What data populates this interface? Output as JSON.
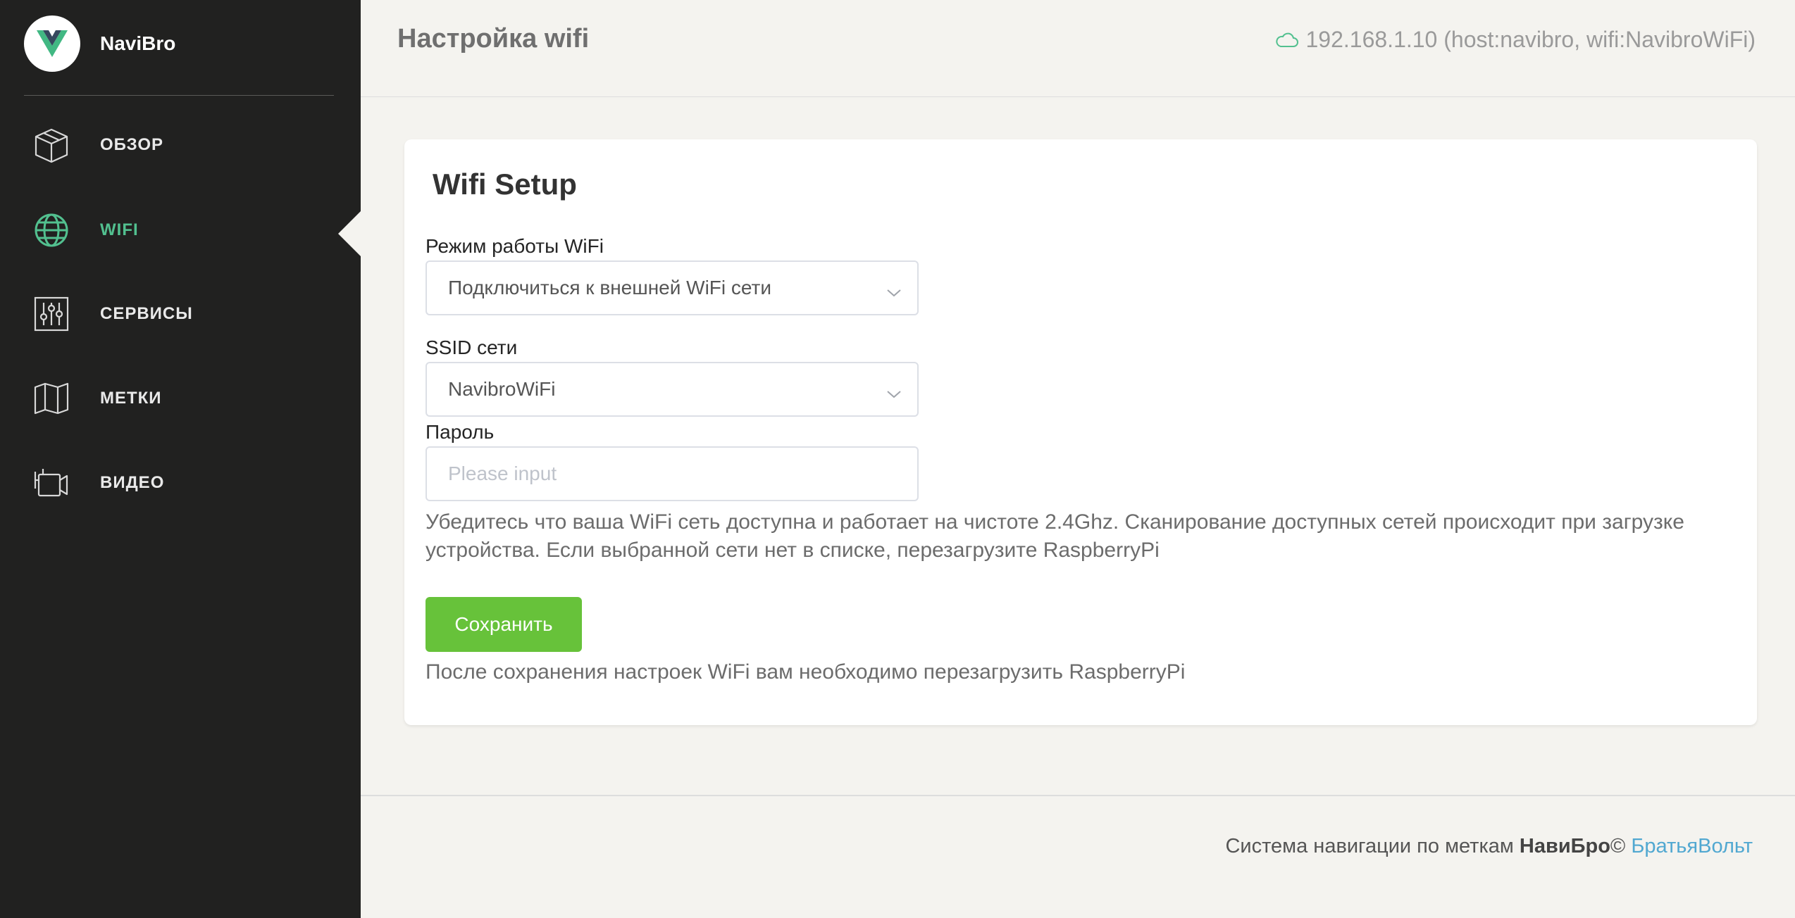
{
  "app": {
    "name": "NaviBro",
    "logo_icon": "vue-logo-icon"
  },
  "sidebar": {
    "items": [
      {
        "label": "ОБЗОР",
        "icon": "box-icon",
        "active": false
      },
      {
        "label": "WIFI",
        "icon": "globe-icon",
        "active": true
      },
      {
        "label": "СЕРВИСЫ",
        "icon": "sliders-icon",
        "active": false
      },
      {
        "label": "МЕТКИ",
        "icon": "map-icon",
        "active": false
      },
      {
        "label": "ВИДЕО",
        "icon": "video-camera-icon",
        "active": false
      }
    ]
  },
  "header": {
    "title": "Настройка wifi",
    "host_info": "192.168.1.10 (host:navibro, wifi:NavibroWiFi)",
    "host_icon": "cloud-icon"
  },
  "card": {
    "title": "Wifi Setup",
    "mode_label": "Режим работы WiFi",
    "mode_value": "Подключиться к внешней WiFi сети",
    "ssid_label": "SSID сети",
    "ssid_value": "NavibroWiFi",
    "password_label": "Пароль",
    "password_placeholder": "Please input",
    "password_value": "",
    "hint": "Убедитесь что ваша WiFi сеть доступна и работает на чистоте 2.4Ghz. Сканирование доступных сетей происходит при загрузке устройства. Если выбранной сети нет в списке, перезагрузите RaspberryPi",
    "save_label": "Сохранить",
    "after_save_note": "После сохранения настроек WiFi вам необходимо перезагрузить RaspberryPi"
  },
  "footer": {
    "text": "Система навигации по меткам",
    "brand": "НавиБро",
    "copyright": "©",
    "link": "БратьяВольт"
  },
  "colors": {
    "sidebar_bg": "#212120",
    "accent_green": "#52c08f",
    "button_green": "#67c23a",
    "page_bg": "#f4f3ef",
    "link_blue": "#51a8d1"
  }
}
